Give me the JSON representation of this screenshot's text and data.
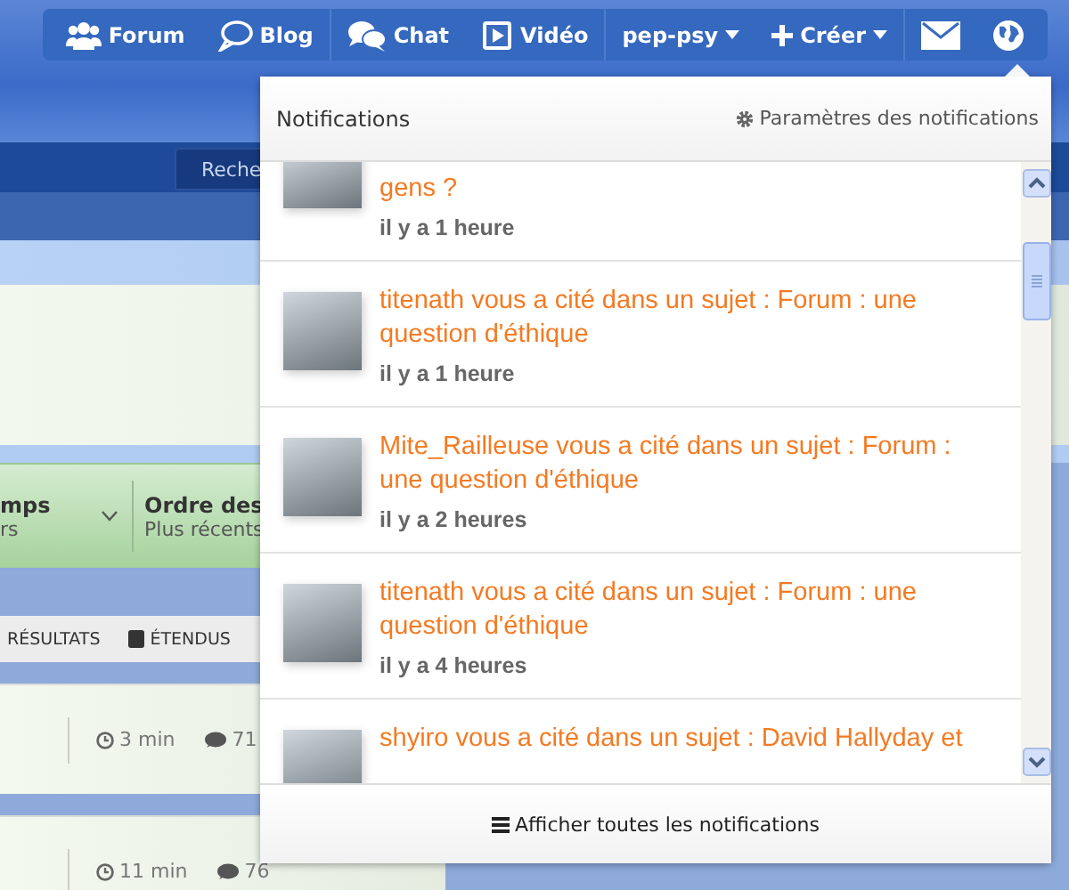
{
  "navbar": {
    "items": [
      {
        "kind": "link",
        "label": "Forum"
      },
      {
        "kind": "link",
        "label": "Blog"
      },
      {
        "kind": "link",
        "label": "Chat"
      },
      {
        "kind": "link",
        "label": "Vidéo"
      },
      {
        "kind": "menu",
        "label": "pep-psy"
      },
      {
        "kind": "menu",
        "label": "Créer"
      },
      {
        "kind": "icon"
      },
      {
        "kind": "icon"
      }
    ]
  },
  "page": {
    "search_button": "Reche",
    "filters": [
      {
        "kind": "dropdown",
        "title": "mps",
        "subtitle": "rs"
      },
      {
        "kind": "plain",
        "title": "Ordre des",
        "subtitle": "Plus récents"
      }
    ],
    "view_options": [
      {
        "kind": "plain",
        "label": "RÉSULTATS"
      },
      {
        "kind": "square",
        "label": "ÉTENDUS"
      }
    ],
    "rows": [
      {
        "time": "3 min",
        "replies": "71"
      },
      {
        "time": "11 min",
        "replies": "76"
      }
    ]
  },
  "notifications": {
    "title": "Notifications",
    "settings_link": "Paramètres des notifications",
    "items": [
      {
        "text": "gens ?",
        "time": "il y a 1 heure"
      },
      {
        "text": "titenath vous a cité dans un sujet : Forum : une question d'éthique",
        "time": "il y a 1 heure"
      },
      {
        "text": "Mite_Railleuse vous a cité dans un sujet : Forum : une question d'éthique",
        "time": "il y a 2 heures"
      },
      {
        "text": "titenath vous a cité dans un sujet : Forum : une question d'éthique",
        "time": "il y a 4 heures"
      },
      {
        "text": "shyiro vous a cité dans un sujet : David Hallyday et"
      }
    ],
    "footer_link": "Afficher toutes les notifications"
  }
}
